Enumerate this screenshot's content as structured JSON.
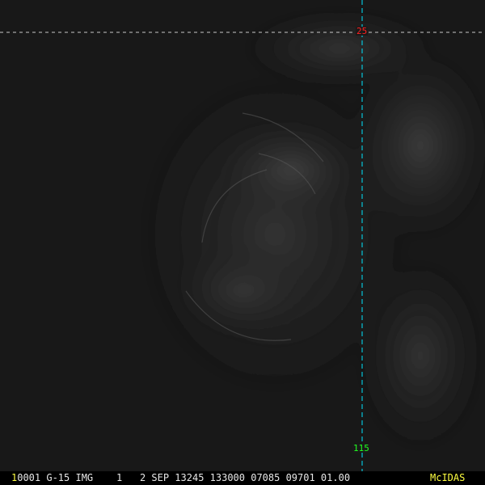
{
  "grid": {
    "latitude_label": "25",
    "longitude_label": "115",
    "latitude_color": "#ff2020",
    "longitude_color": "#20ff20",
    "lat_line_color": "#c8c8c8",
    "lon_line_color": "#00e5ff"
  },
  "status_bar": {
    "frame_number": "1",
    "info": "0001 G-15 IMG    1   2 SEP 13245 133000 07085 09701 01.00",
    "brand": "McIDAS"
  }
}
